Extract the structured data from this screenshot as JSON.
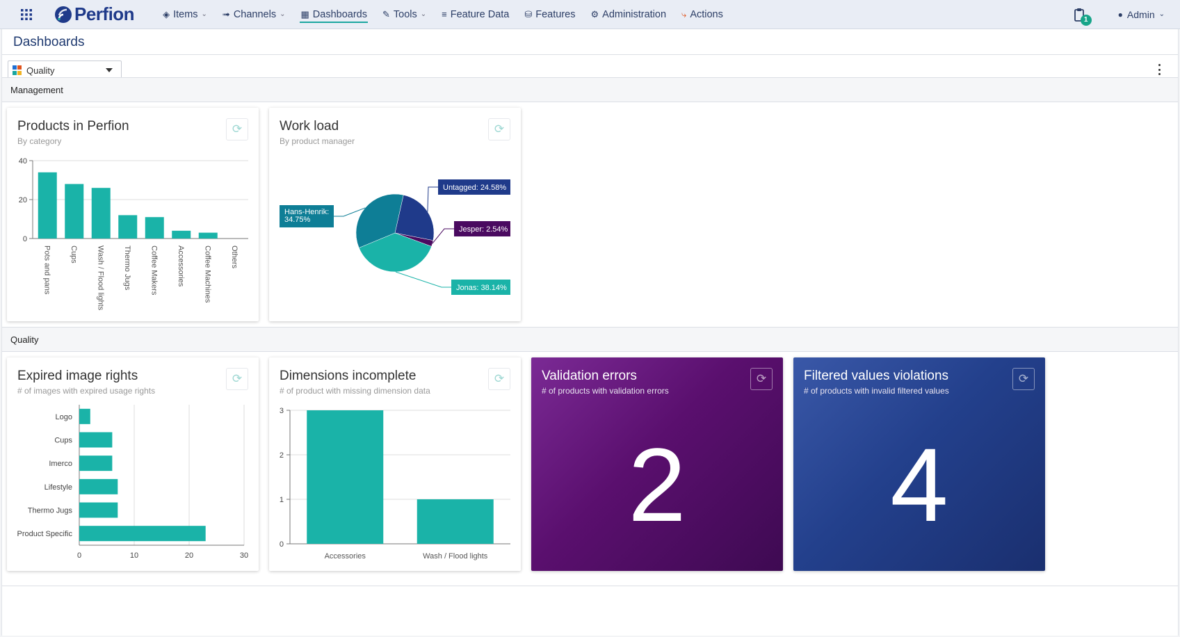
{
  "app": {
    "logo_text": "Perfion",
    "brand_color": "#1f3a8a",
    "accent_color": "#1aa7a0"
  },
  "nav": [
    {
      "label": "Items",
      "icon": "cube-icon",
      "dropdown": true
    },
    {
      "label": "Channels",
      "icon": "channel-icon",
      "dropdown": true
    },
    {
      "label": "Dashboards",
      "icon": "dashboard-icon",
      "dropdown": false,
      "active": true
    },
    {
      "label": "Tools",
      "icon": "wrench-icon",
      "dropdown": true
    },
    {
      "label": "Feature Data",
      "icon": "list-icon",
      "dropdown": false
    },
    {
      "label": "Features",
      "icon": "database-icon",
      "dropdown": false
    },
    {
      "label": "Administration",
      "icon": "gear-icon",
      "dropdown": false
    },
    {
      "label": "Actions",
      "icon": "actions-icon",
      "dropdown": false
    }
  ],
  "notifications": {
    "count": "1"
  },
  "user": {
    "name": "Admin"
  },
  "page": {
    "title": "Dashboards"
  },
  "dashboard_select": {
    "value": "Quality"
  },
  "sections": {
    "management": "Management",
    "quality": "Quality"
  },
  "cards": {
    "products": {
      "title": "Products in Perfion",
      "subtitle": "By category"
    },
    "workload": {
      "title": "Work load",
      "subtitle": "By product manager"
    },
    "expired": {
      "title": "Expired image rights",
      "subtitle": "# of images with expired usage rights"
    },
    "dimensions": {
      "title": "Dimensions incomplete",
      "subtitle": "# of product with missing dimension data"
    },
    "validation": {
      "title": "Validation errors",
      "subtitle": "# of products with validation errors",
      "value": "2",
      "color": "#5a0f6e"
    },
    "filtered": {
      "title": "Filtered values violations",
      "subtitle": "# of products with invalid filtered values",
      "value": "4",
      "color": "#23408c"
    }
  },
  "chart_data": [
    {
      "id": "products",
      "type": "bar",
      "categories": [
        "Pots and pans",
        "Cups",
        "Wash / Flood lights",
        "Thermo Jugs",
        "Coffee Makers",
        "Accessories",
        "Coffee Machines",
        "Others"
      ],
      "values": [
        34,
        28,
        26,
        12,
        11,
        4,
        3,
        0
      ],
      "ylim": [
        0,
        40
      ],
      "yticks": [
        0,
        20,
        40
      ],
      "color": "#1ab3a8",
      "grid": true
    },
    {
      "id": "workload",
      "type": "pie",
      "slices": [
        {
          "name": "Untagged",
          "label": "Untagged: 24.58%",
          "value": 24.58,
          "color": "#1f3a8a"
        },
        {
          "name": "Jesper",
          "label": "Jesper: 2.54%",
          "value": 2.54,
          "color": "#4a0a60"
        },
        {
          "name": "Jonas",
          "label": "Jonas: 38.14%",
          "value": 38.14,
          "color": "#1ab3a8"
        },
        {
          "name": "Hans-Henrik",
          "label_lines": [
            "Hans-Henrik:",
            "34.75%"
          ],
          "value": 34.75,
          "color": "#0e7e96"
        }
      ]
    },
    {
      "id": "expired",
      "type": "bar",
      "orientation": "horizontal",
      "categories": [
        "Logo",
        "Cups",
        "Imerco",
        "Lifestyle",
        "Thermo Jugs",
        "Product Specific"
      ],
      "values": [
        2,
        6,
        6,
        7,
        7,
        23
      ],
      "xlim": [
        0,
        30
      ],
      "xticks": [
        0,
        10,
        20,
        30
      ],
      "color": "#1ab3a8",
      "grid": true
    },
    {
      "id": "dimensions",
      "type": "bar",
      "categories": [
        "Accessories",
        "Wash / Flood lights"
      ],
      "values": [
        3,
        1
      ],
      "ylim": [
        0,
        3
      ],
      "yticks": [
        0,
        1,
        2,
        3
      ],
      "color": "#1ab3a8",
      "grid": true
    }
  ]
}
